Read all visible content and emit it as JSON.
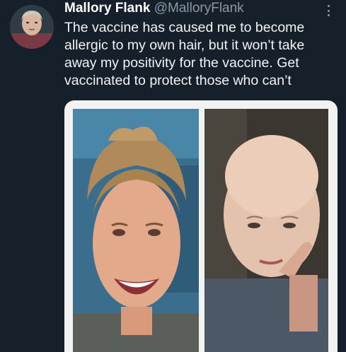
{
  "tweet": {
    "display_name": "Mallory Flank",
    "handle": "@MalloryFlank",
    "text": "The vaccine has caused me to become\nallergic to my own hair, but it won’t take\naway my positivity for the vaccine. Get\nvaccinated to protect those who can’t"
  },
  "icons": {
    "more": "more-vertical-icon",
    "avatar": "profile-avatar"
  },
  "colors": {
    "background": "#15202b",
    "name": "#ffffff",
    "handle": "#8b98a5",
    "text": "#f1f3f5",
    "media_frame": "#f2f2f2"
  }
}
